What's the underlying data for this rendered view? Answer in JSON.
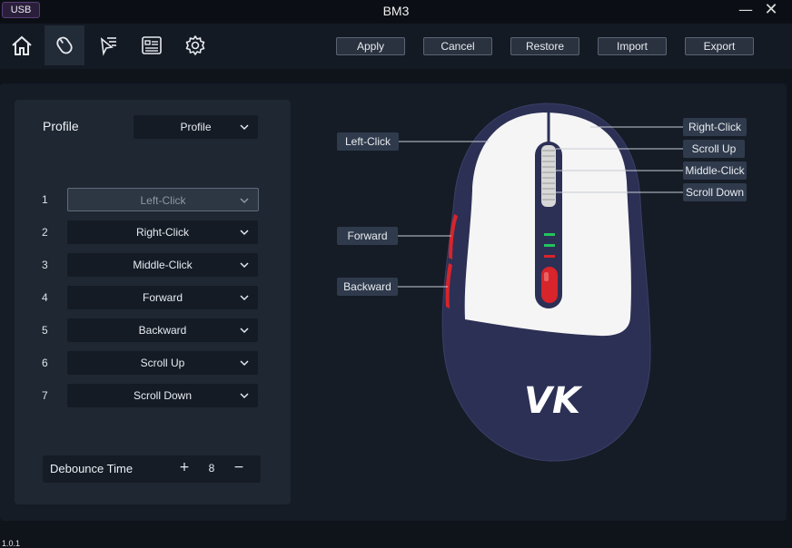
{
  "titlebar": {
    "badge": "USB",
    "title": "BM3",
    "minimize": "—",
    "close": "✕"
  },
  "nav": [
    {
      "icon": "home-icon"
    },
    {
      "icon": "mouse-icon"
    },
    {
      "icon": "cursor-list-icon"
    },
    {
      "icon": "list-panel-icon"
    },
    {
      "icon": "gear-icon"
    }
  ],
  "actions": {
    "apply": "Apply",
    "cancel": "Cancel",
    "restore": "Restore",
    "import": "Import",
    "export": "Export"
  },
  "profile": {
    "label": "Profile",
    "selected": "Profile"
  },
  "buttons": [
    {
      "num": "1",
      "value": "Left-Click",
      "disabled": true
    },
    {
      "num": "2",
      "value": "Right-Click"
    },
    {
      "num": "3",
      "value": "Middle-Click"
    },
    {
      "num": "4",
      "value": "Forward"
    },
    {
      "num": "5",
      "value": "Backward"
    },
    {
      "num": "6",
      "value": "Scroll Up"
    },
    {
      "num": "7",
      "value": "Scroll Down"
    }
  ],
  "debounce": {
    "label": "Debounce Time",
    "plus": "+",
    "value": "8",
    "minus": "−"
  },
  "mouse_labels": {
    "left_click": "Left-Click",
    "forward": "Forward",
    "backward": "Backward",
    "right_click": "Right-Click",
    "scroll_up": "Scroll Up",
    "middle_click": "Middle-Click",
    "scroll_down": "Scroll Down",
    "logo_text": "VK"
  },
  "version": "1.0.1",
  "colors": {
    "accent_red": "#d8242b",
    "led_green": "#22c55e",
    "mouse_body": "#2c3055",
    "mouse_top": "#f5f5f5"
  }
}
